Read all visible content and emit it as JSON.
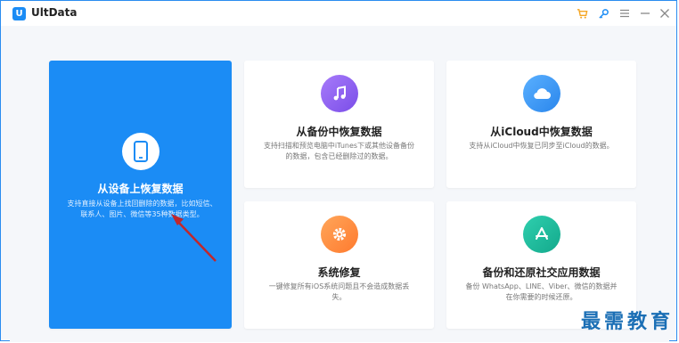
{
  "app": {
    "title": "UltData",
    "logo_letter": "U"
  },
  "titlebar": {
    "icons": [
      "cart-icon",
      "key-icon",
      "menu-icon",
      "minimize-icon",
      "close-icon"
    ]
  },
  "cards": [
    {
      "title": "从设备上恢复数据",
      "desc": "支持直接从设备上找回删除的数据，比如短信、联系人、图片、微信等35种数据类型。",
      "icon": "phone-icon",
      "color": "#ffffff"
    },
    {
      "title": "从备份中恢复数据",
      "desc": "支持扫描和预览电脑中iTunes下或其他设备备份的数据，包含已经删除过的数据。",
      "icon": "music-note-icon",
      "color": "#8a5cf5"
    },
    {
      "title": "从iCloud中恢复数据",
      "desc": "支持从iCloud中恢复已同步至iCloud的数据。",
      "icon": "cloud-icon",
      "color": "#2f8ff0"
    },
    {
      "title": "系统修复",
      "desc": "一键修复所有iOS系统问题且不会造成数据丢失。",
      "icon": "gear-icon",
      "color": "#ff8a3d"
    },
    {
      "title": "备份和还原社交应用数据",
      "desc": "备份 WhatsApp、LINE、Viber、微信的数据并在你需要的时候还原。",
      "icon": "app-store-icon",
      "color": "#19b79a"
    }
  ],
  "watermark": "最需教育",
  "colors": {
    "accent": "#1b8cf5",
    "annotation_arrow": "#c0282d"
  }
}
